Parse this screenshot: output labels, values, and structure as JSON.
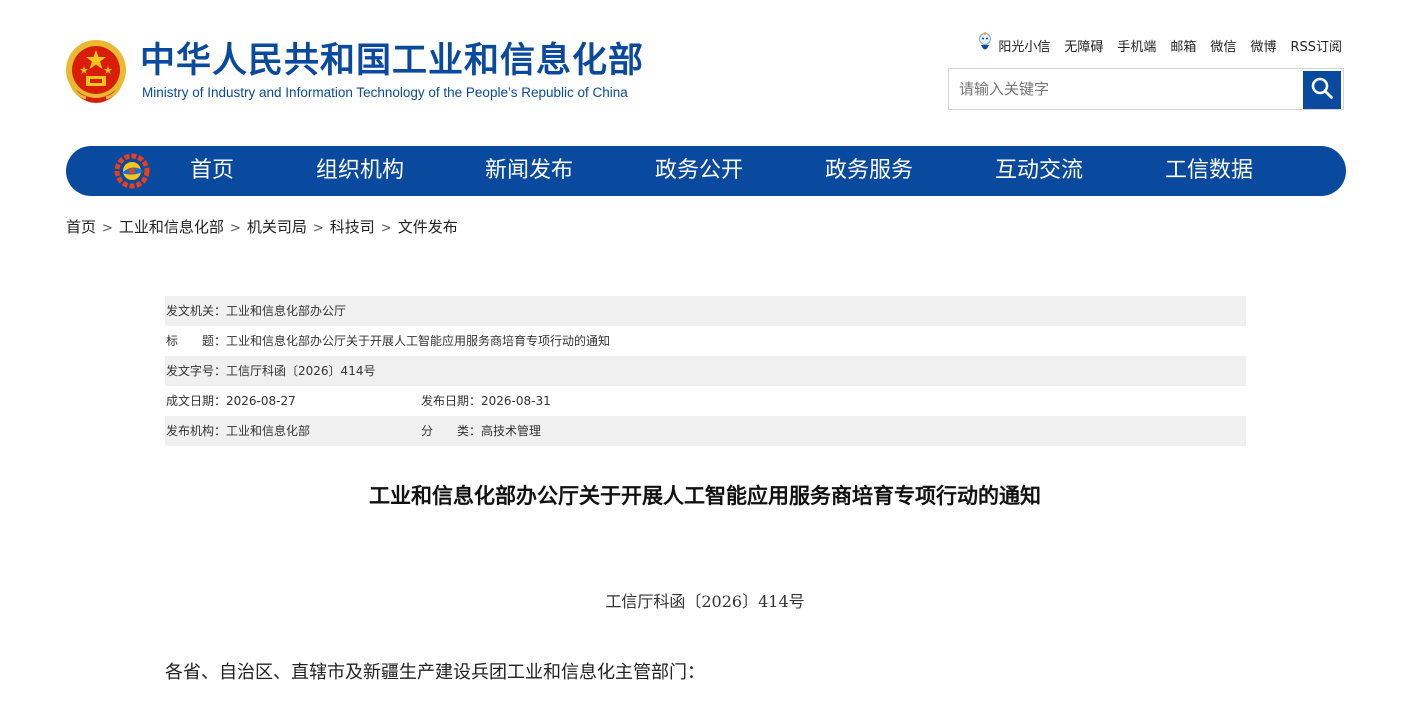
{
  "header": {
    "title_cn": "中华人民共和国工业和信息化部",
    "title_en": "Ministry of Industry and Information Technology of the People’s Republic of China",
    "toplinks": [
      "阳光小信",
      "无障碍",
      "手机端",
      "邮箱",
      "微信",
      "微博",
      "RSS订阅"
    ],
    "search_placeholder": "请输入关键字"
  },
  "nav": {
    "items": [
      "首页",
      "组织机构",
      "新闻发布",
      "政务公开",
      "政务服务",
      "互动交流",
      "工信数据"
    ]
  },
  "breadcrumb": [
    "首页",
    "工业和信息化部",
    "机关司局",
    "科技司",
    "文件发布"
  ],
  "meta": {
    "issuer_label": "发文机关：",
    "issuer": "工业和信息化部办公厅",
    "subject_label": "标　　题：",
    "subject": "工业和信息化部办公厅关于开展人工智能应用服务商培育专项行动的通知",
    "docno_label": "发文字号：",
    "docno": "工信厅科函〔2026〕414号",
    "written_label": "成文日期：",
    "written": "2026-08-27",
    "published_label": "发布日期：",
    "published": "2026-08-31",
    "org_label": "发布机构：",
    "org": "工业和信息化部",
    "category_label": "分　　类：",
    "category": "高技术管理"
  },
  "article": {
    "title": "工业和信息化部办公厅关于开展人工智能应用服务商培育专项行动的通知",
    "docno": "工信厅科函〔2026〕414号",
    "salutation": "各省、自治区、直辖市及新疆生产建设兵团工业和信息化主管部门："
  },
  "colors": {
    "primary": "#0a4a9e",
    "meta_row_bg": "#f0f0f0",
    "emblem_red": "#d81e06",
    "emblem_gold": "#f5c518"
  }
}
